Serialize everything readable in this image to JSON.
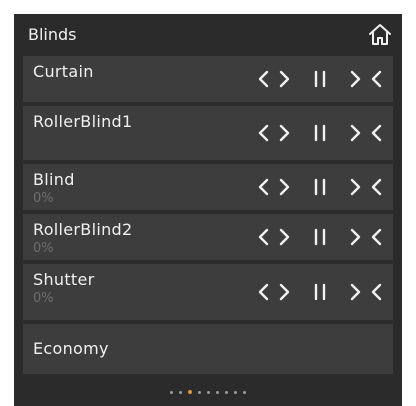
{
  "header": {
    "title": "Blinds",
    "home_icon": "home-icon"
  },
  "rows": [
    {
      "name": "Curtain",
      "value": "",
      "controls": true
    },
    {
      "name": "RollerBlind1",
      "value": "",
      "controls": true
    },
    {
      "name": "Blind",
      "value": "0%",
      "controls": true
    },
    {
      "name": "RollerBlind2",
      "value": "0%",
      "controls": true
    },
    {
      "name": "Shutter",
      "value": "0%",
      "controls": true
    },
    {
      "name": "Economy",
      "value": "",
      "controls": false
    }
  ],
  "controls": {
    "open_icon": "open-arrows-icon",
    "stop_icon": "pause-icon",
    "close_icon": "close-arrows-icon"
  },
  "pagination": {
    "total_pages": 9,
    "current_page": 3
  },
  "colors": {
    "panel_bg": "#2b2b2b",
    "row_bg": "#3d3d3d",
    "text": "#f0f0f0",
    "muted_text": "#6e6e6e",
    "active_dot": "#e0953a"
  }
}
